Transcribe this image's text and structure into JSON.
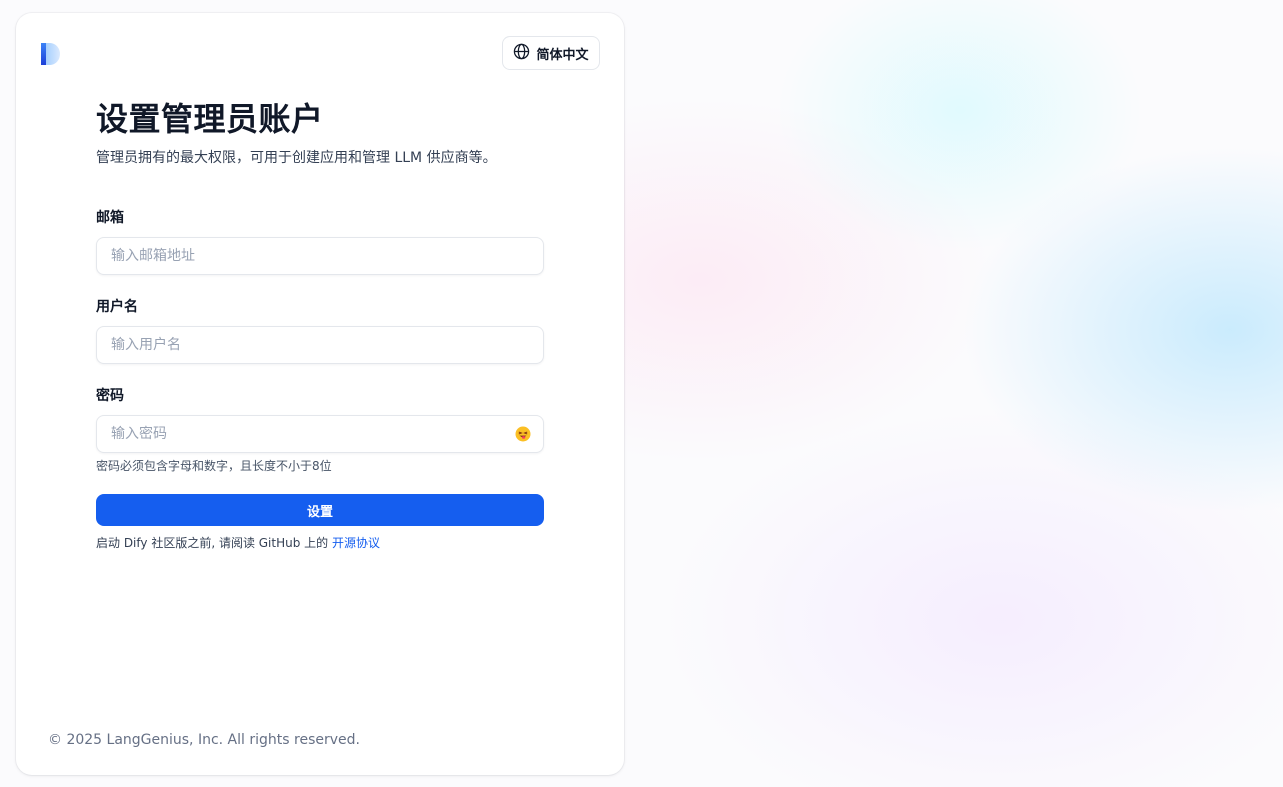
{
  "header": {
    "logo_icon": "dify-logo-icon",
    "language_icon": "globe-icon",
    "language_label": "简体中文"
  },
  "main": {
    "title": "设置管理员账户",
    "subtitle": "管理员拥有的最大权限，可用于创建应用和管理 LLM 供应商等。"
  },
  "form": {
    "email": {
      "label": "邮箱",
      "placeholder": "输入邮箱地址",
      "value": ""
    },
    "username": {
      "label": "用户名",
      "placeholder": "输入用户名",
      "value": ""
    },
    "password": {
      "label": "密码",
      "placeholder": "输入密码",
      "value": "",
      "toggle_icon": "show-password-emoji-icon",
      "hint": "密码必须包含字母和数字，且长度不小于8位"
    },
    "submit_label": "设置"
  },
  "notice": {
    "text": "启动 Dify 社区版之前, 请阅读 GitHub 上的 ",
    "link_label": "开源协议"
  },
  "footer": {
    "copyright": "© 2025 LangGenius, Inc. All rights reserved."
  },
  "colors": {
    "primary": "#155eef",
    "title": "#101828",
    "muted": "#667085",
    "border": "#e4e7ec"
  }
}
